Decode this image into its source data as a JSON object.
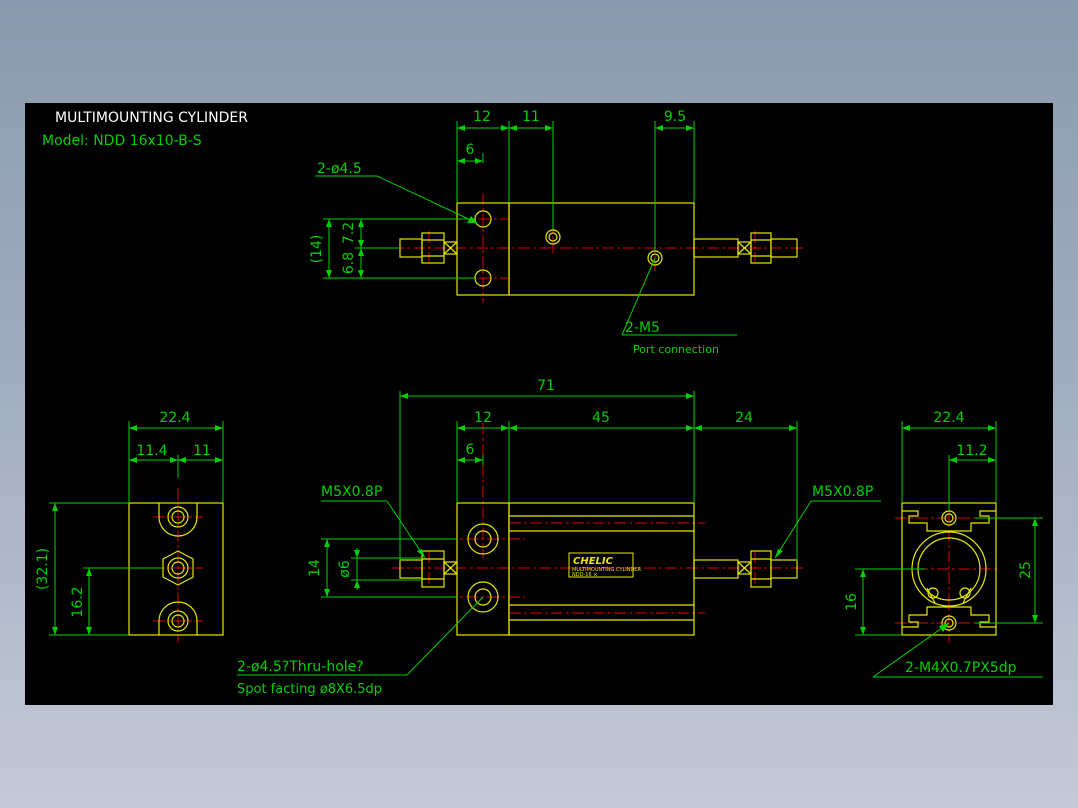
{
  "title": {
    "heading": "MULTIMOUNTING CYLINDER",
    "model": "Model: NDD 16x10-B-S"
  },
  "colors": {
    "background": "#000000",
    "outline": "#e6e600",
    "dimension": "#00d000",
    "centerline": "#e00000",
    "text_white": "#ffffff",
    "frame": "#a6b1c2"
  },
  "top_view": {
    "dims": {
      "d12": "12",
      "d11": "11",
      "d9_5": "9.5",
      "d6": "6",
      "d7_2": "7.2",
      "d6_8": "6.8",
      "d14": "(14)"
    },
    "callouts": {
      "hole": "2-ø4.5",
      "port": "2-M5",
      "port_note": "Port connection"
    }
  },
  "front_view": {
    "dims": {
      "d71": "71",
      "d12": "12",
      "d45": "45",
      "d24": "24",
      "d6": "6",
      "d14": "14",
      "d_phi6": "ø6"
    },
    "callouts": {
      "thread_left": "M5X0.8P",
      "thread_right": "M5X0.8P",
      "hole": "2-ø4.5?Thru-hole?",
      "spot": "Spot facting  ø8X6.5dp"
    },
    "label": {
      "brand": "CHELIC",
      "line1": "MULTIMOUNTING CYLINDER",
      "line2": "NDD-16 ×"
    }
  },
  "left_view": {
    "dims": {
      "d22_4": "22.4",
      "d11_4": "11.4",
      "d11": "11",
      "d32_1": "(32.1)",
      "d16_2": "16.2"
    }
  },
  "right_view": {
    "dims": {
      "d22_4": "22.4",
      "d11_2": "11.2",
      "d25": "25",
      "d16": "16"
    },
    "callouts": {
      "thread": "2-M4X0.7PX5dp"
    }
  }
}
